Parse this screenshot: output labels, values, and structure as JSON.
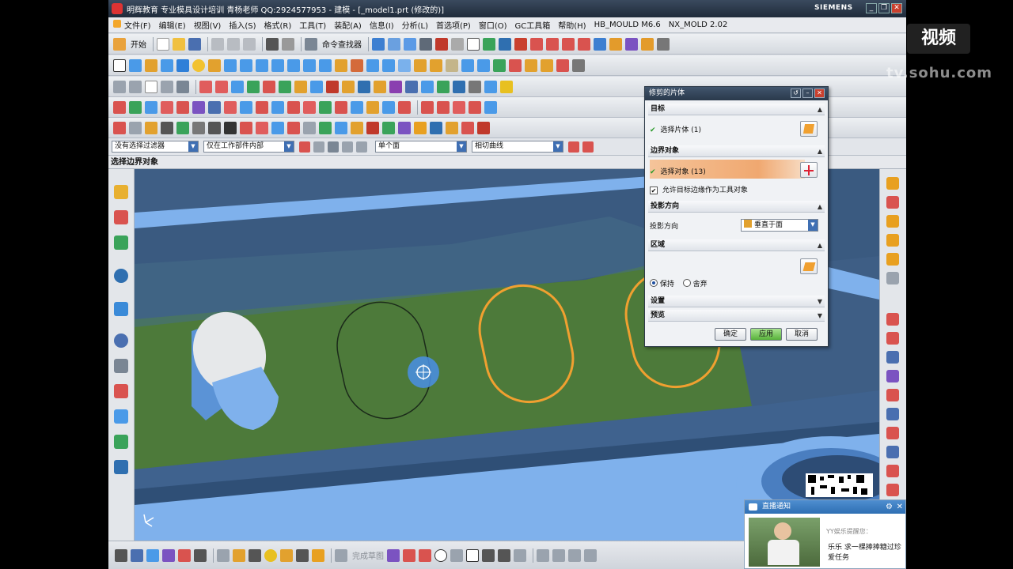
{
  "window": {
    "title": "明辉教育 专业模具设计培训 青杨老师 QQ:2924577953 - 建模 - [_model1.prt (修改的)]",
    "brand": "SIEMENS"
  },
  "menu": [
    "文件(F)",
    "编辑(E)",
    "视图(V)",
    "插入(S)",
    "格式(R)",
    "工具(T)",
    "装配(A)",
    "信息(I)",
    "分析(L)",
    "首选项(P)",
    "窗口(O)",
    "GC工具箱",
    "帮助(H)",
    "HB_MOULD M6.6",
    "NX_MOLD 2.02"
  ],
  "toolbar": {
    "start_label": "开始",
    "command_finder_label": "命令查找器"
  },
  "filters": {
    "type_filter": "没有选择过滤器",
    "scope_filter": "仅在工作部件内部",
    "face_rule": "单个面",
    "curve_rule": "相切曲线"
  },
  "cue_line": "选择边界对象",
  "dialog": {
    "title": "修剪的片体",
    "target": {
      "header": "目标",
      "select_label": "选择片体 (1)"
    },
    "boundary": {
      "header": "边界对象",
      "select_label": "选择对象 (13)",
      "allow_edges_label": "允许目标边缘作为工具对象",
      "allow_edges_checked": true
    },
    "projection": {
      "header": "投影方向",
      "label": "投影方向",
      "value": "垂直于面"
    },
    "region": {
      "header": "区域",
      "keep_label": "保持",
      "discard_label": "舍弃",
      "selected": "保持"
    },
    "settings_header": "设置",
    "preview_header": "预览",
    "buttons": {
      "ok": "确定",
      "apply": "应用",
      "cancel": "取消"
    }
  },
  "bottom_toolbar": {
    "finish_sketch_label": "完成草图"
  },
  "notification": {
    "title": "直播通知",
    "sender": "YY娱乐提醒您：",
    "message": "乐乐  求一棵捧捧糖过珍爱任务"
  },
  "watermark": {
    "brand": "视频",
    "url": "tv.sohu.com"
  },
  "colors": {
    "viewport_bg": "#3e5e85",
    "model_blue": "#7fb1ec",
    "sheet_green": "#4d7a3a",
    "highlight_orange": "#f0a030",
    "dialog_active_row": "#f0b07a"
  }
}
